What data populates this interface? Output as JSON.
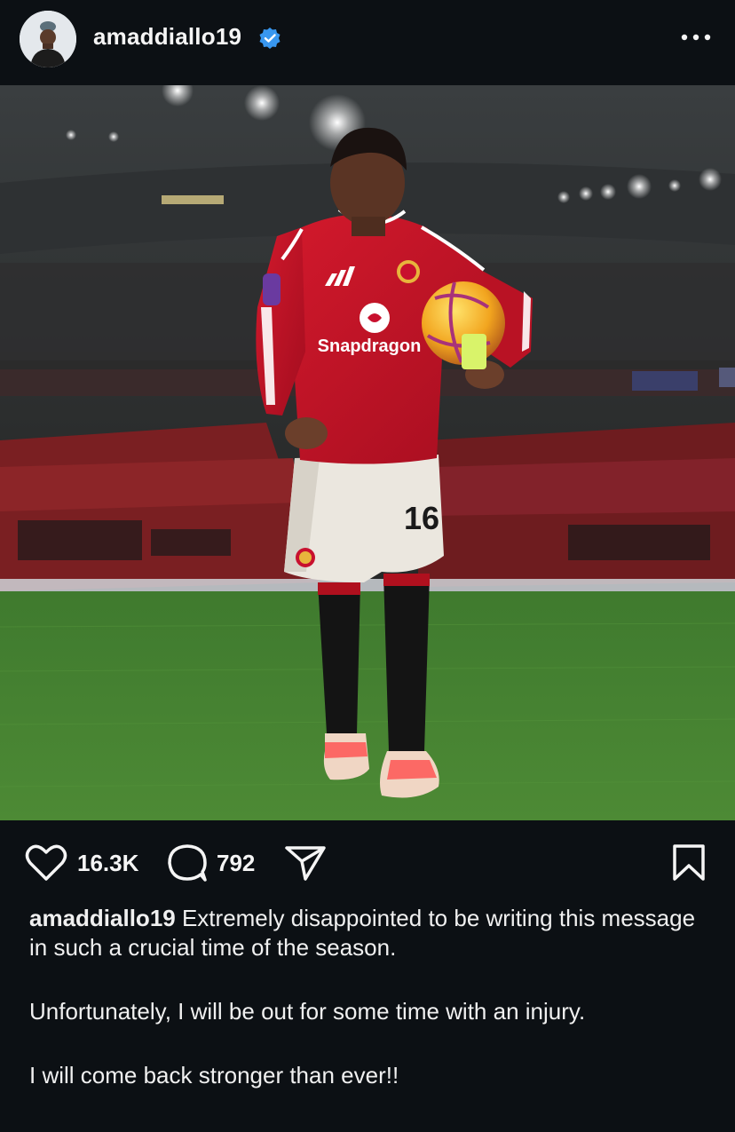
{
  "post": {
    "username": "amaddiallo19",
    "verified": true,
    "likes": "16.3K",
    "comments": "792"
  },
  "caption": {
    "username": "amaddiallo19",
    "line1": "Extremely disappointed to be writing this message in such a crucial time of the season.",
    "line2": "Unfortunately, I will be out for some time with an injury.",
    "line3": "I will come back stronger than ever!!"
  },
  "photo": {
    "sponsor": "Snapdragon",
    "shirt_number": "16"
  },
  "icons": {
    "verified": "verified-badge-icon",
    "more": "more-options-icon",
    "like": "heart-icon",
    "comment": "comment-icon",
    "share": "share-icon",
    "save": "bookmark-icon"
  },
  "colors": {
    "background": "#0c1014",
    "verified_blue": "#3897f0",
    "jersey_red": "#c8102e"
  }
}
